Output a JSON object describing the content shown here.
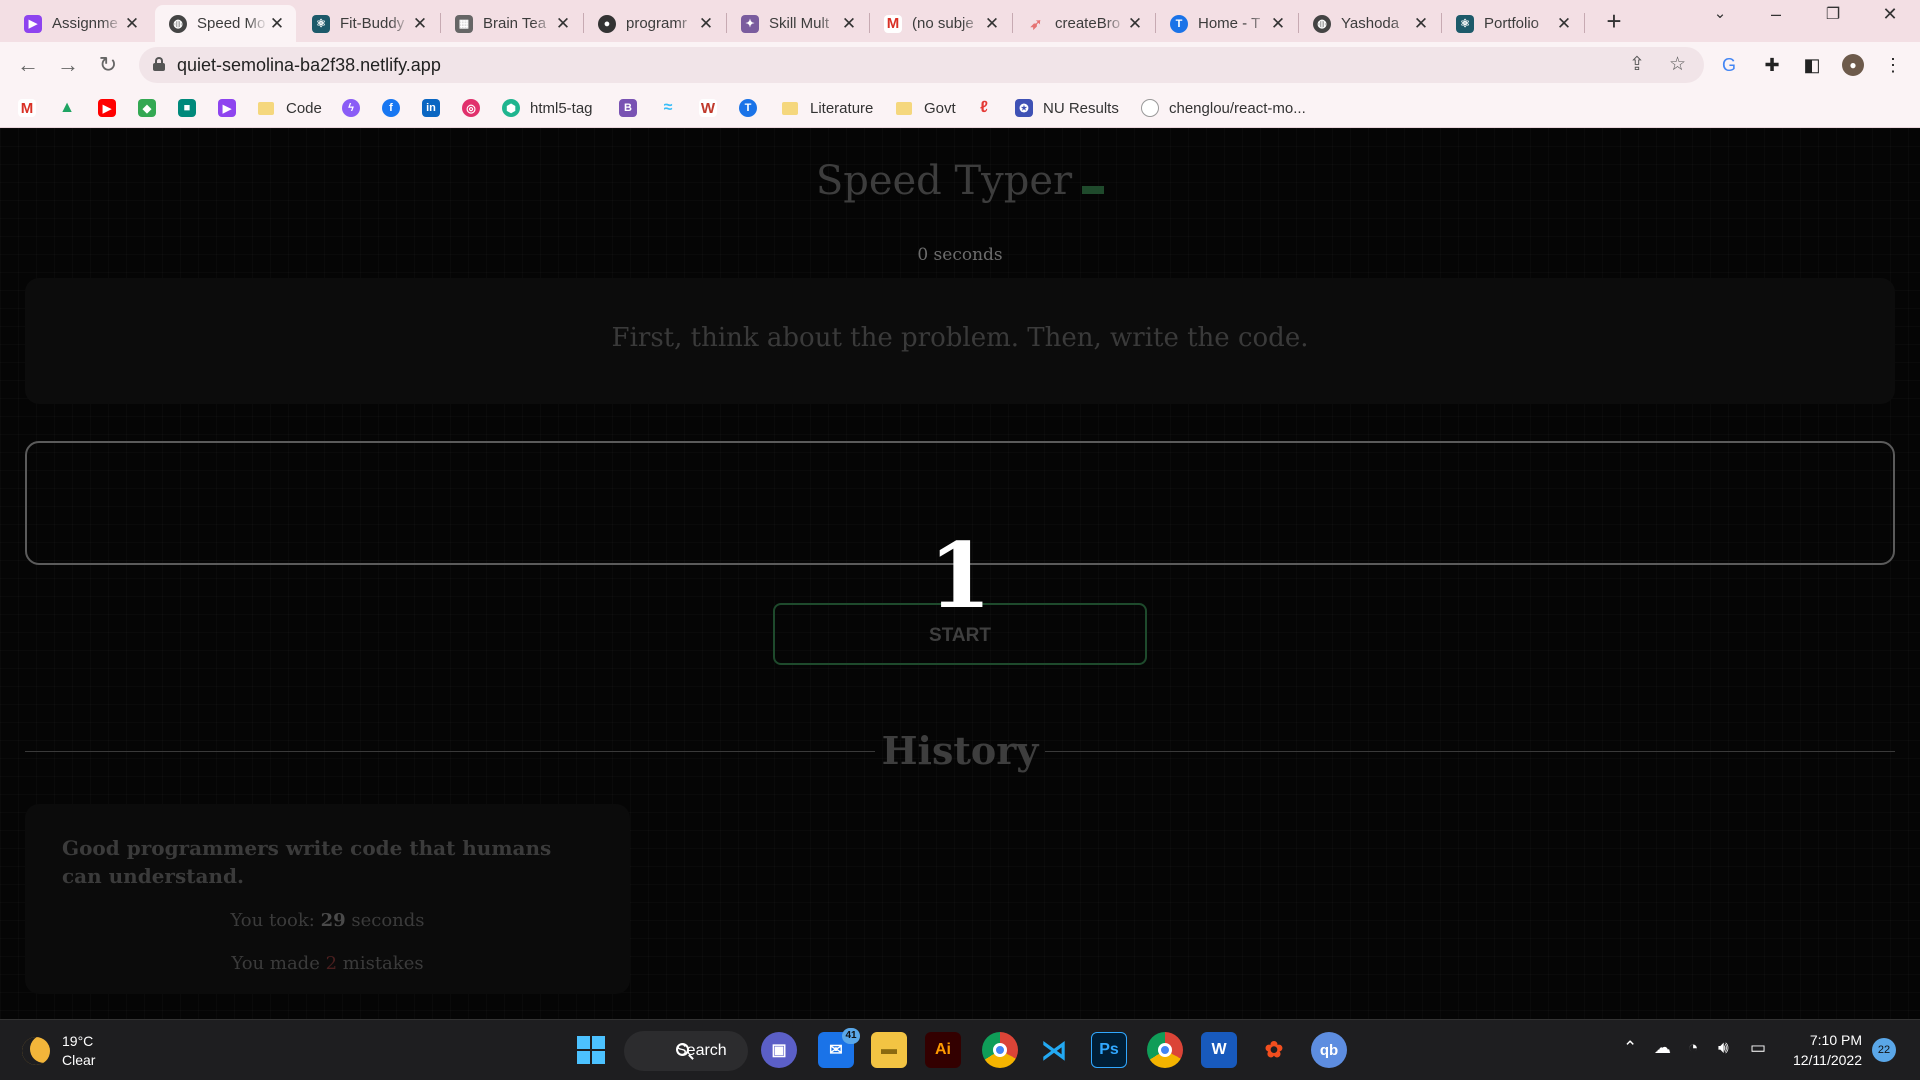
{
  "browser": {
    "tabs": [
      {
        "label": "Assignme",
        "icon": "assignment-icon",
        "color": "#8e44ef"
      },
      {
        "label": "Speed Mo",
        "icon": "globe-icon",
        "color": "#444444"
      },
      {
        "label": "Fit-Buddy",
        "icon": "react-icon",
        "color": "#1d5a6a"
      },
      {
        "label": "Brain Tea",
        "icon": "grid-icon",
        "color": "#666666"
      },
      {
        "label": "programr",
        "icon": "github-icon",
        "color": "#333333"
      },
      {
        "label": "Skill Mult",
        "icon": "skill-icon",
        "color": "#7a5c9e"
      },
      {
        "label": "(no subje",
        "icon": "gmail-icon",
        "color": "#d93025"
      },
      {
        "label": "createBro",
        "icon": "create-icon",
        "color": "#e57373"
      },
      {
        "label": "Home - T",
        "icon": "t-icon",
        "color": "#1a73e8"
      },
      {
        "label": "Yashoda",
        "icon": "globe-icon",
        "color": "#444444"
      },
      {
        "label": "Portfolio",
        "icon": "react-icon",
        "color": "#1d5a6a"
      }
    ],
    "url": "quiet-semolina-ba2f38.netlify.app",
    "bookmarks": [
      {
        "label": "",
        "icon": "gmail-icon",
        "color": "#d93025"
      },
      {
        "label": "",
        "icon": "drive-icon",
        "color": "#1fa463"
      },
      {
        "label": "",
        "icon": "youtube-icon",
        "color": "#ff0000"
      },
      {
        "label": "",
        "icon": "maps-icon",
        "color": "#34a853"
      },
      {
        "label": "",
        "icon": "meet-icon",
        "color": "#00897b"
      },
      {
        "label": "",
        "icon": "assignment-icon",
        "color": "#8e44ef"
      },
      {
        "label": "Code",
        "icon": "folder-icon",
        "color": "#f5d77d"
      },
      {
        "label": "",
        "icon": "messenger-icon",
        "color": "#8a5cf6"
      },
      {
        "label": "",
        "icon": "facebook-icon",
        "color": "#1877f2"
      },
      {
        "label": "",
        "icon": "linkedin-icon",
        "color": "#0a66c2"
      },
      {
        "label": "",
        "icon": "instagram-icon",
        "color": "#e1306c"
      },
      {
        "label": "html5-tag",
        "icon": "html5-icon",
        "color": "#1fb58f"
      },
      {
        "label": "",
        "icon": "bootstrap-icon",
        "color": "#7952b3"
      },
      {
        "label": "",
        "icon": "tailwind-icon",
        "color": "#38bdf8"
      },
      {
        "label": "",
        "icon": "w-icon",
        "color": "#c0392b"
      },
      {
        "label": "",
        "icon": "t-icon",
        "color": "#1a73e8"
      },
      {
        "label": "Literature",
        "icon": "folder-icon",
        "color": "#f5d77d"
      },
      {
        "label": "Govt",
        "icon": "folder-icon",
        "color": "#f5d77d"
      },
      {
        "label": "",
        "icon": "acrobat-icon",
        "color": "#e53935"
      },
      {
        "label": "NU Results",
        "icon": "nu-icon",
        "color": "#3f51b5"
      },
      {
        "label": "chenglou/react-mo...",
        "icon": "github-icon",
        "color": "#333333"
      }
    ]
  },
  "app": {
    "title": "Speed Typer",
    "timer": "0 seconds",
    "quote": "First, think about the problem. Then, write the code.",
    "countdown": "1",
    "start_label": "START",
    "accent": "#1e4a2c",
    "history": {
      "heading": "History",
      "entries": [
        {
          "quote": "Good programmers write code that humans can understand.",
          "time_prefix": "You took: ",
          "time_value": "29",
          "time_suffix": " seconds",
          "mistakes_prefix": "You made ",
          "mistakes_value": "2",
          "mistakes_suffix": " mistakes"
        }
      ]
    }
  },
  "taskbar": {
    "weather_temp": "19°C",
    "weather_desc": "Clear",
    "search_label": "Search",
    "mail_badge": "41",
    "time": "7:10 PM",
    "date": "12/11/2022",
    "notifications": "22",
    "apps": [
      {
        "name": "start-icon"
      },
      {
        "name": "teams-icon"
      },
      {
        "name": "mail-icon"
      },
      {
        "name": "file-explorer-icon"
      },
      {
        "name": "illustrator-icon",
        "label": "Ai"
      },
      {
        "name": "chrome-icon"
      },
      {
        "name": "vscode-icon"
      },
      {
        "name": "photoshop-icon",
        "label": "Ps"
      },
      {
        "name": "chrome-profile-icon"
      },
      {
        "name": "word-icon",
        "label": "W"
      },
      {
        "name": "figma-icon"
      },
      {
        "name": "qbittorrent-icon",
        "label": "qb"
      }
    ]
  }
}
